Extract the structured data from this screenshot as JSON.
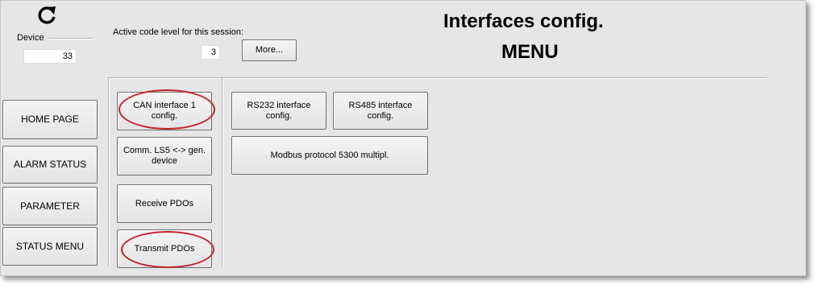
{
  "header": {
    "refresh_icon": "refresh-icon",
    "device_label": "Device",
    "device_value": "33",
    "code_level_label": "Active code level for this session:",
    "code_level_value": "3",
    "more_label": "More...",
    "title_line1": "Interfaces config.",
    "title_line2": "MENU"
  },
  "nav": {
    "home_page": "HOME PAGE",
    "alarm_status": "ALARM STATUS",
    "parameter": "PARAMETER",
    "status_menu": "STATUS MENU"
  },
  "menu": {
    "can_interface_1": "CAN interface 1 config.",
    "comm_ls5": "Comm. LS5 <-> gen. device",
    "receive_pdos": "Receive PDOs",
    "transmit_pdos": "Transmit PDOs",
    "rs232": "RS232 interface config.",
    "rs485": "RS485 interface config.",
    "modbus": "Modbus protocol 5300 multipl."
  },
  "colors": {
    "panel_bg": "#e6e6e6",
    "highlight": "#c0262c"
  }
}
